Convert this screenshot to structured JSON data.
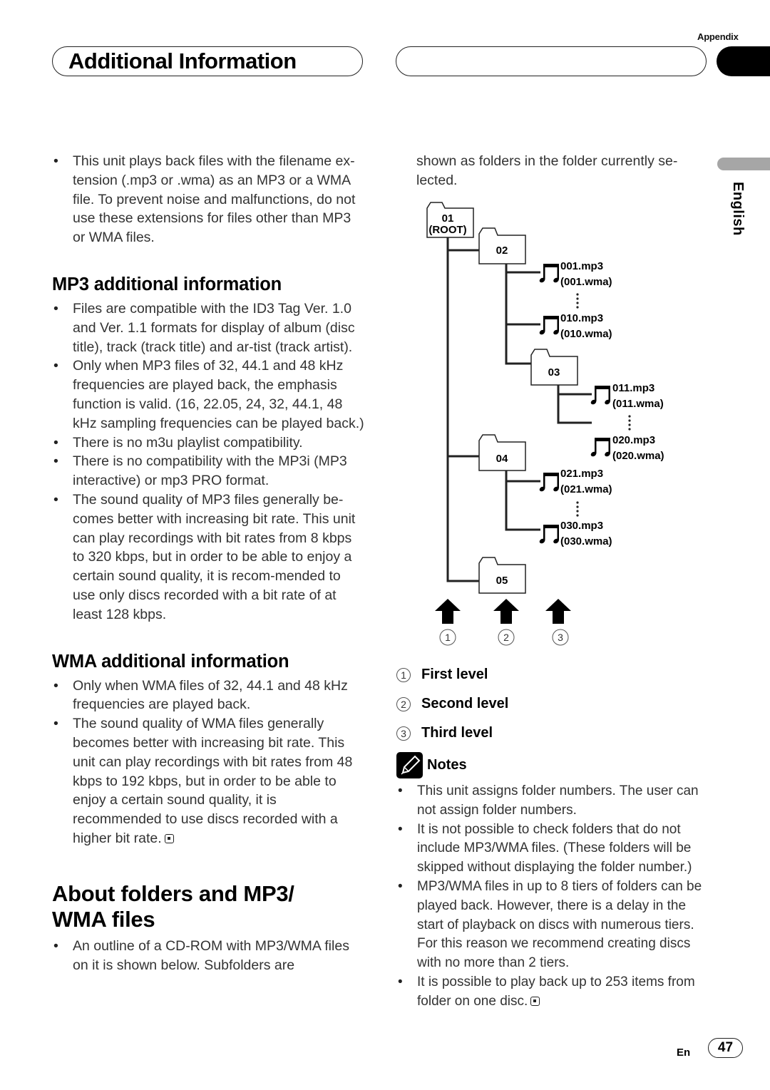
{
  "header": {
    "section_label": "Appendix",
    "title": "Additional Information",
    "language_tab": "English"
  },
  "left": {
    "intro_bullets": [
      "This unit plays back files with the filename ex-tension (.mp3 or .wma) as an MP3 or a WMA file. To prevent noise and malfunctions, do not use these extensions for files other than MP3 or WMA files."
    ],
    "mp3_heading": "MP3 additional information",
    "mp3_bullets": [
      "Files are compatible with the ID3 Tag Ver. 1.0 and Ver. 1.1 formats for display of album (disc title), track (track title) and ar-tist (track artist).",
      "Only when MP3 files of 32, 44.1 and 48 kHz frequencies are played back, the emphasis function is valid. (16, 22.05, 24, 32, 44.1, 48 kHz sampling frequencies can be played back.)",
      "There is no m3u playlist compatibility.",
      "There is no compatibility with the MP3i (MP3 interactive) or mp3 PRO format.",
      "The sound quality of MP3 files generally be-comes better with increasing bit rate. This unit can play recordings with bit rates from 8 kbps to 320 kbps, but in order to be able to enjoy a certain sound quality, it is recom-mended to use only discs recorded with a bit rate of at least 128 kbps."
    ],
    "wma_heading": "WMA additional information",
    "wma_bullets": [
      "Only when WMA files of 32, 44.1 and 48 kHz frequencies are played back.",
      "The sound quality of WMA files generally becomes better with increasing bit rate. This unit can play recordings with bit rates from 48 kbps to 192 kbps, but in order to be able to enjoy a certain sound quality, it is recommended to use discs recorded with a higher bit rate."
    ],
    "folders_heading_line1": "About folders and MP3/",
    "folders_heading_line2": "WMA files",
    "folders_bullets": [
      "An outline of a CD-ROM with MP3/WMA files on it is shown below. Subfolders are"
    ]
  },
  "right": {
    "continuation": "shown as folders in the folder currently se-lected.",
    "diagram": {
      "folders": [
        {
          "id": "01",
          "sub": "(ROOT)"
        },
        {
          "id": "02"
        },
        {
          "id": "03"
        },
        {
          "id": "04"
        },
        {
          "id": "05"
        }
      ],
      "files": [
        {
          "mp3": "001.mp3",
          "wma": "(001.wma)"
        },
        {
          "mp3": "010.mp3",
          "wma": "(010.wma)"
        },
        {
          "mp3": "011.mp3",
          "wma": "(011.wma)"
        },
        {
          "mp3": "020.mp3",
          "wma": "(020.wma)"
        },
        {
          "mp3": "021.mp3",
          "wma": "(021.wma)"
        },
        {
          "mp3": "030.mp3",
          "wma": "(030.wma)"
        }
      ],
      "level_markers": [
        "1",
        "2",
        "3"
      ]
    },
    "legend": [
      {
        "num": "1",
        "label": "First level"
      },
      {
        "num": "2",
        "label": "Second level"
      },
      {
        "num": "3",
        "label": "Third level"
      }
    ],
    "notes_heading": "Notes",
    "notes": [
      "This unit assigns folder numbers. The user can not assign folder numbers.",
      "It is not possible to check folders that do not include MP3/WMA files. (These folders will be skipped without displaying the folder number.)",
      "MP3/WMA files in up to 8 tiers of folders can be played back. However, there is a delay in the start of playback on discs with numerous tiers. For this reason we recommend creating discs with no more than 2 tiers.",
      "It is possible to play back up to 253 items from folder on one disc."
    ]
  },
  "footer": {
    "lang_code": "En",
    "page_number": "47"
  }
}
